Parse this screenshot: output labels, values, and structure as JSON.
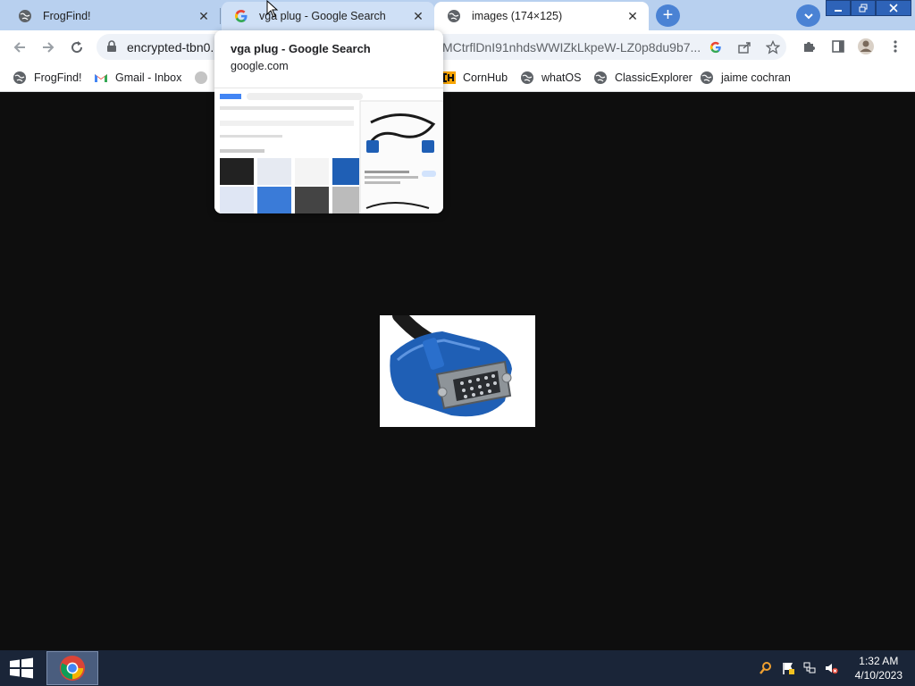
{
  "tabs": [
    {
      "title": "FrogFind!",
      "icon": "globe-icon",
      "close": "✕"
    },
    {
      "title": "vga plug - Google Search",
      "icon": "google-icon",
      "close": "✕"
    },
    {
      "title": "images (174×125)",
      "icon": "globe-icon",
      "close": "✕"
    }
  ],
  "new_tab": "+",
  "address_bar": {
    "url_left": "encrypted-tbn0.",
    "url_right": "MCtrflDnI91nhdsWWIZkLkpeW-LZ0p8du9b7..."
  },
  "bookmarks": [
    {
      "label": "FrogFind!",
      "icon": "globe-icon"
    },
    {
      "label": "Gmail - Inbox",
      "icon": "gmail-icon"
    },
    {
      "label": "CornHub",
      "icon": "ch-logo-icon"
    },
    {
      "label": "whatOS",
      "icon": "globe-icon"
    },
    {
      "label": "ClassicExplorer",
      "icon": "globe-icon"
    },
    {
      "label": "jaime cochran",
      "icon": "globe-icon"
    }
  ],
  "hover_card": {
    "title": "vga plug - Google Search",
    "domain": "google.com"
  },
  "taskbar": {
    "time": "1:32 AM",
    "date": "4/10/2023"
  },
  "colors": {
    "tabstrip": "#b8d0ef",
    "accent": "#4a82d4",
    "content_bg": "#0e0e0e",
    "taskbar": "#1a2538",
    "vga_blue": "#1f5fb5"
  }
}
